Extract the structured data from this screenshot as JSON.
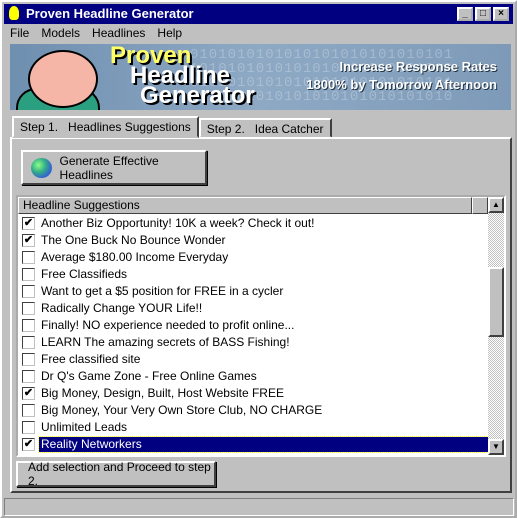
{
  "window": {
    "title": "Proven Headline Generator",
    "controls": [
      "_",
      "□",
      "×"
    ]
  },
  "menu": [
    "File",
    "Models",
    "Headlines",
    "Help"
  ],
  "banner": {
    "logo": [
      "Proven",
      "Headline",
      "Generator"
    ],
    "tagline": [
      "Increase Response Rates",
      "1800% by Tomorrow Afternoon"
    ]
  },
  "tabs": [
    "Step 1.   Headlines Suggestions",
    "Step 2.   Idea Catcher"
  ],
  "generate_button": "Generate Effective Headlines",
  "list": {
    "header": "Headline Suggestions",
    "items": [
      {
        "text": "Another Biz Opportunity! 10K a week? Check it out!",
        "checked": true
      },
      {
        "text": "The One Buck No Bounce Wonder",
        "checked": true
      },
      {
        "text": "Average $180.00 Income Everyday",
        "checked": false
      },
      {
        "text": "Free Classifieds",
        "checked": false
      },
      {
        "text": "Want to get a $5 position for FREE in a cycler",
        "checked": false
      },
      {
        "text": "Radically Change YOUR Life!!",
        "checked": false
      },
      {
        "text": "Finally! NO experience needed to profit online...",
        "checked": false
      },
      {
        "text": "LEARN The amazing secrets of BASS Fishing!",
        "checked": false
      },
      {
        "text": "Free classified site",
        "checked": false
      },
      {
        "text": "Dr Q's Game Zone - Free Online Games",
        "checked": false
      },
      {
        "text": "Big Money, Design, Built, Host Website FREE",
        "checked": true
      },
      {
        "text": "Big Money, Your Very Own Store Club, NO CHARGE",
        "checked": false
      },
      {
        "text": "Unlimited Leads",
        "checked": false
      },
      {
        "text": "Reality Networkers",
        "checked": true,
        "selected": true
      }
    ]
  },
  "proceed_button": "Add selection and Proceed to step 2."
}
